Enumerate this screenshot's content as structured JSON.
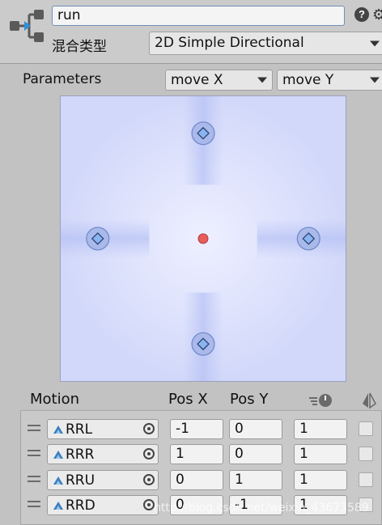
{
  "header": {
    "name_value": "run",
    "blend_type_label": "混合类型",
    "blend_type_value": "2D Simple Directional",
    "help_symbol": "?",
    "icons": [
      "blend-tree-icon",
      "help-icon",
      "gear-icon"
    ]
  },
  "parameters": {
    "label": "Parameters",
    "x": "move X",
    "y": "move Y"
  },
  "blend_space": {
    "background_color": "#d7dcfa",
    "motion_marker_color": "#8ab4f0",
    "current_point_color": "#e85c5c"
  },
  "motions": {
    "headers": {
      "motion": "Motion",
      "pos_x": "Pos X",
      "pos_y": "Pos Y"
    },
    "icons": [
      "speed-icon",
      "mirror-icon"
    ],
    "rows": [
      {
        "clip": "RRL",
        "pos_x": "-1",
        "pos_y": "0",
        "speed": "1"
      },
      {
        "clip": "RRR",
        "pos_x": "1",
        "pos_y": "0",
        "speed": "1"
      },
      {
        "clip": "RRU",
        "pos_x": "0",
        "pos_y": "1",
        "speed": "1"
      },
      {
        "clip": "RRD",
        "pos_x": "0",
        "pos_y": "-1",
        "speed": "1"
      }
    ]
  },
  "watermark": "http://blog.csdn.net/weixin_43673589"
}
